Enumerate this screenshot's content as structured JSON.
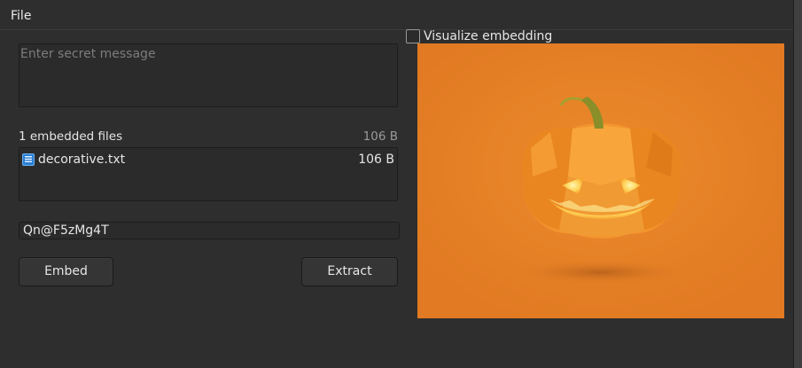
{
  "menu": {
    "file_label": "File"
  },
  "message": {
    "placeholder": "Enter secret message",
    "value": ""
  },
  "files": {
    "header_label": "1 embedded files",
    "total_size": "106 B",
    "items": [
      {
        "name": "decorative.txt",
        "size": "106 B"
      }
    ]
  },
  "password": {
    "value": "Qn@F5zMg4T"
  },
  "buttons": {
    "embed_label": "Embed",
    "extract_label": "Extract"
  },
  "visualize": {
    "label": "Visualize embedding",
    "checked": false
  },
  "preview": {
    "background_color": "#e57e25",
    "subject": "jack-o-lantern pumpkin"
  }
}
